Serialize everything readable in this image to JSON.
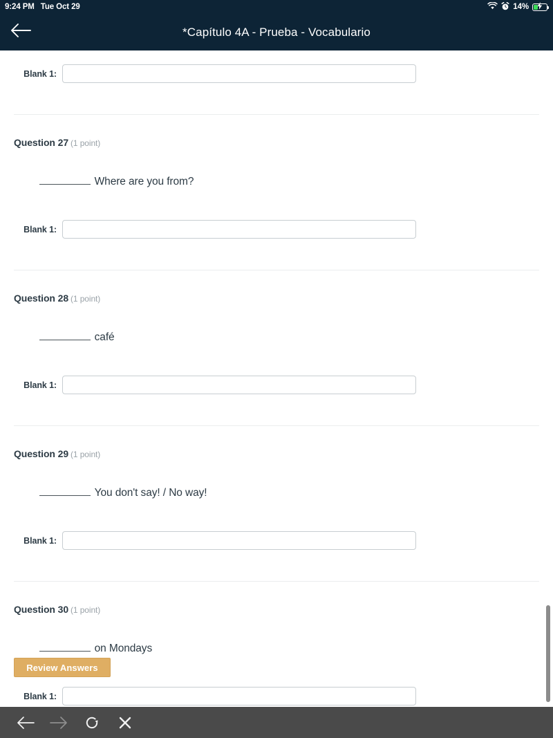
{
  "status_bar": {
    "time": "9:24 PM",
    "date": "Tue Oct 29",
    "battery_percent": "14%",
    "icons": {
      "wifi": "wifi-icon",
      "alarm": "alarm-clock-icon",
      "battery": "battery-charging-icon"
    },
    "battery_fill_color": "#3ddc5b"
  },
  "header": {
    "back_icon": "arrow-left-icon",
    "title": "*Capítulo 4A - Prueba - Vocabulario",
    "background_color": "#0d2436"
  },
  "content": {
    "top_blank": {
      "label": "Blank 1:",
      "value": "",
      "placeholder": ""
    },
    "questions": [
      {
        "number": "Question 27",
        "points": "(1 point)",
        "text": "Where are you from?",
        "blank_label": "Blank 1:",
        "blank_value": "",
        "blank_placeholder": ""
      },
      {
        "number": "Question 28",
        "points": "(1 point)",
        "text": "café",
        "blank_label": "Blank 1:",
        "blank_value": "",
        "blank_placeholder": ""
      },
      {
        "number": "Question 29",
        "points": "(1 point)",
        "text": "You don't say! / No way!",
        "blank_label": "Blank 1:",
        "blank_value": "",
        "blank_placeholder": ""
      },
      {
        "number": "Question 30",
        "points": "(1 point)",
        "text": "on Mondays",
        "blank_label": "Blank 1:",
        "blank_value": "",
        "blank_placeholder": ""
      }
    ],
    "review_button": {
      "label": "Review Answers",
      "color": "#dfae63"
    }
  },
  "bottom_toolbar": {
    "background_color": "#4a4a4a",
    "buttons": [
      {
        "name": "back-arrow-icon",
        "enabled": true
      },
      {
        "name": "forward-arrow-icon",
        "enabled": false
      },
      {
        "name": "reload-icon",
        "enabled": true
      },
      {
        "name": "close-icon",
        "enabled": true
      }
    ]
  }
}
